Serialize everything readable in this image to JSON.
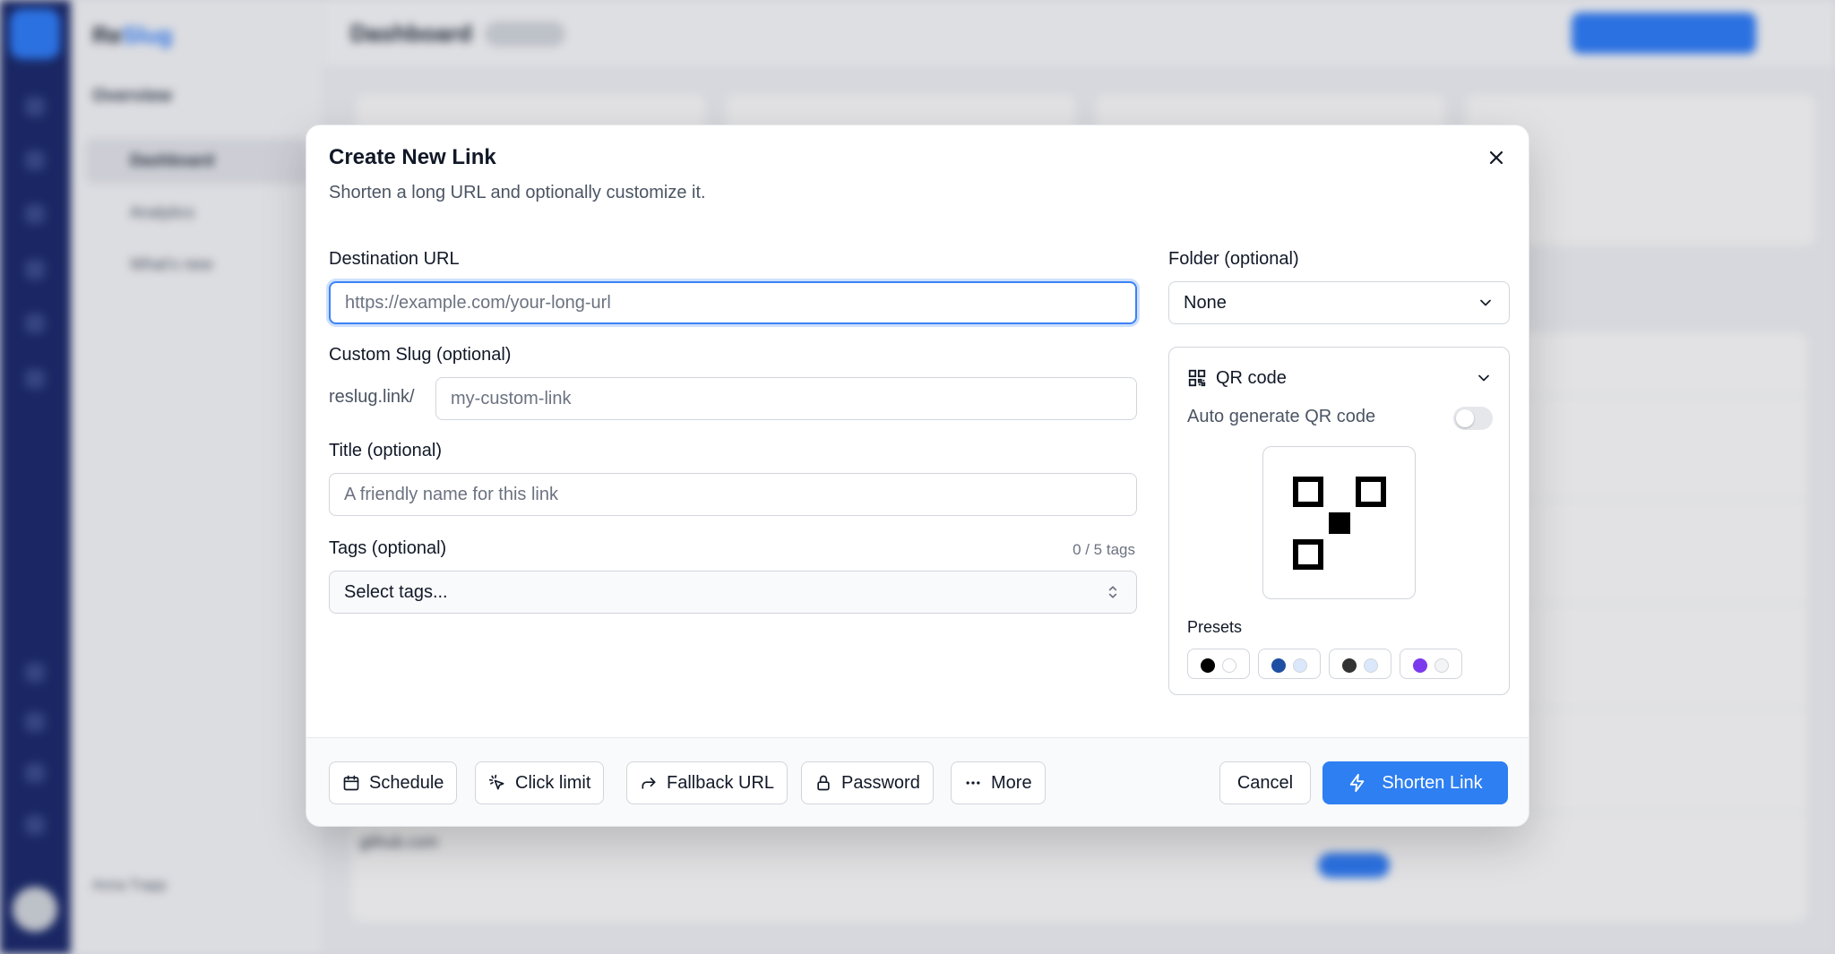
{
  "dialog": {
    "title": "Create New Link",
    "subtitle": "Shorten a long URL and optionally customize it."
  },
  "form": {
    "destination": {
      "label": "Destination URL",
      "placeholder": "https://example.com/your-long-url",
      "value": ""
    },
    "slug": {
      "label": "Custom Slug (optional)",
      "prefix": "reslug.link/",
      "placeholder": "my-custom-link",
      "value": ""
    },
    "title": {
      "label": "Title (optional)",
      "placeholder": "A friendly name for this link",
      "value": ""
    },
    "tags": {
      "label": "Tags (optional)",
      "count": "0 / 5 tags",
      "placeholder": "Select tags..."
    },
    "folder": {
      "label": "Folder (optional)",
      "value": "None"
    }
  },
  "qr": {
    "title": "QR code",
    "auto_label": "Auto generate QR code",
    "auto_enabled": false,
    "presets_label": "Presets",
    "presets": [
      {
        "fg": "#000000",
        "bg": "#ffffff"
      },
      {
        "fg": "#1e4fa3",
        "bg": "#dbe8fb"
      },
      {
        "fg": "#333333",
        "bg": "#dbe8fb"
      },
      {
        "fg": "#7c3aed",
        "bg": "#f3f4f6"
      }
    ]
  },
  "footer": {
    "schedule": "Schedule",
    "click_limit": "Click limit",
    "fallback_url": "Fallback URL",
    "password": "Password",
    "more": "More",
    "cancel": "Cancel",
    "submit": "Shorten Link"
  },
  "colors": {
    "accent": "#2d7ff2",
    "focus_ring": "#3b82f6"
  }
}
